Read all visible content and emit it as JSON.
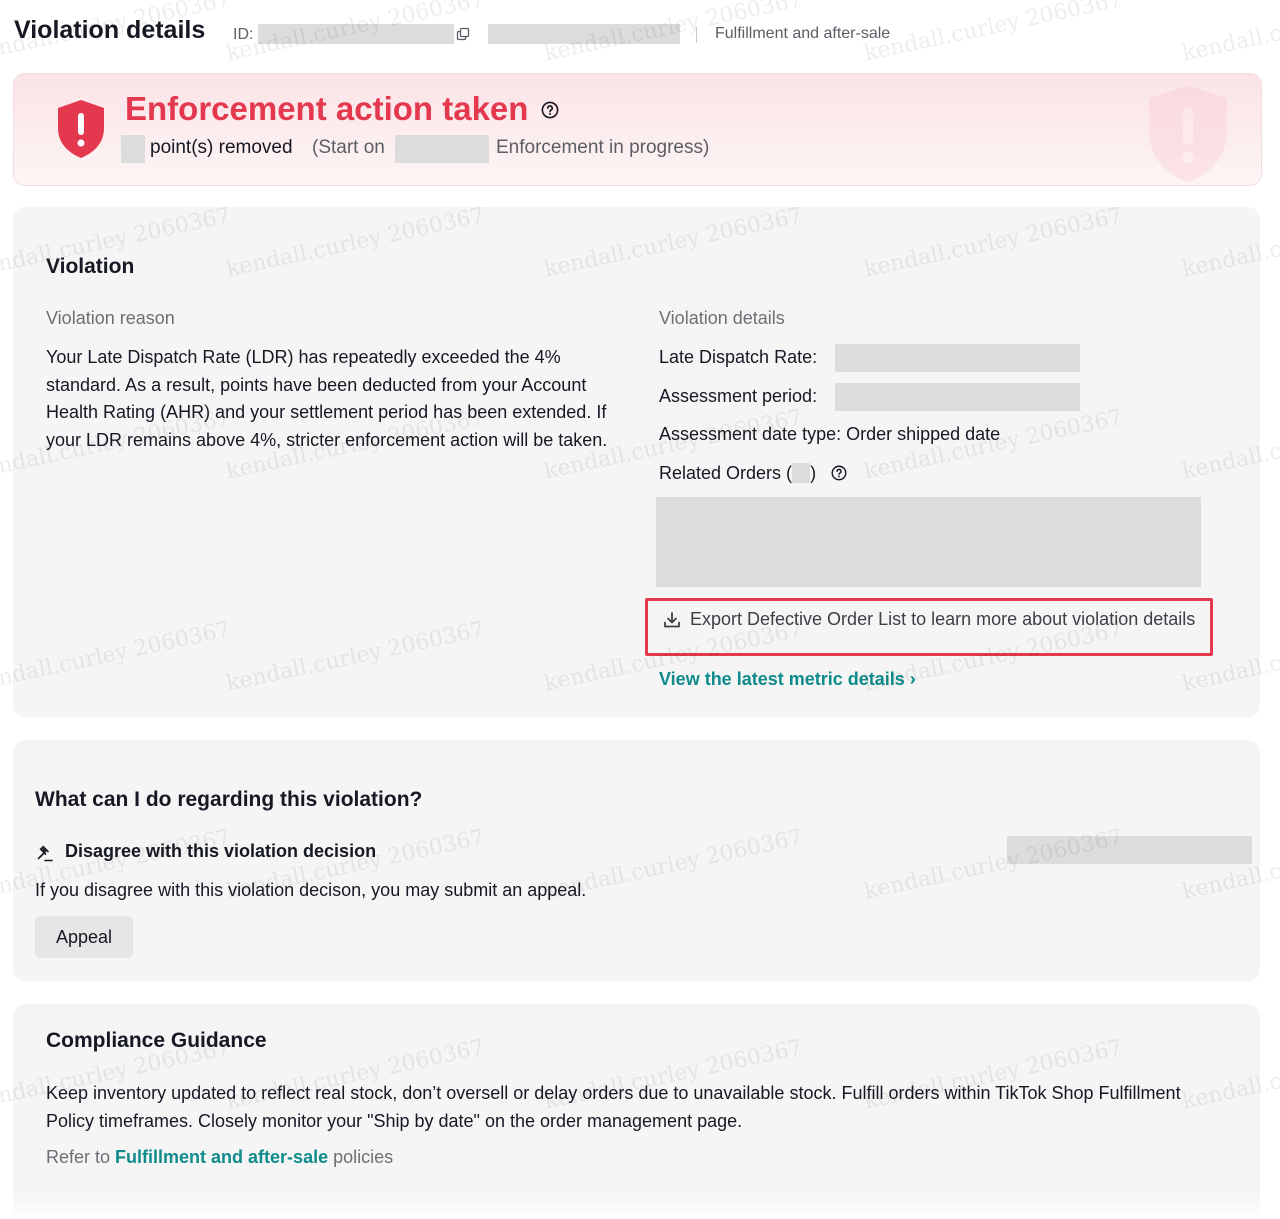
{
  "header": {
    "title": "Violation details",
    "id_label": "ID:",
    "category": "Fulfillment and after-sale"
  },
  "banner": {
    "title": "Enforcement action taken",
    "points_text": "point(s) removed",
    "start_text": "(Start on",
    "progress_text": "Enforcement in progress)"
  },
  "violation": {
    "title": "Violation",
    "reason_label": "Violation reason",
    "reason_text": "Your Late Dispatch Rate (LDR) has repeatedly exceeded the 4% standard. As a result, points have been deducted from your Account Health Rating (AHR) and your settlement period has been extended. If your LDR remains above 4%, stricter enforcement action will be taken.",
    "details_label": "Violation details",
    "late_dispatch_label": "Late Dispatch Rate:",
    "assessment_period_label": "Assessment period:",
    "assessment_date_type": "Assessment date type: Order shipped date",
    "related_orders_label": "Related Orders (",
    "related_orders_close": ")",
    "export_link": "Export Defective Order List to learn more about violation details",
    "metric_link": "View the latest metric details ›"
  },
  "what_to_do": {
    "title": "What can I do regarding this violation?",
    "disagree_title": "Disagree with this violation decision",
    "disagree_text": "If you disagree with this violation decison, you may submit an appeal.",
    "appeal_button": "Appeal"
  },
  "compliance": {
    "title": "Compliance Guidance",
    "text": "Keep inventory updated to reflect real stock, don’t oversell or delay orders due to unavailable stock. Fulfill orders within TikTok Shop Fulfillment Policy timeframes. Closely monitor your \"Ship by date\" on the order management page.",
    "refer_prefix": "Refer to",
    "refer_link": "Fulfillment and after-sale",
    "refer_suffix": "policies"
  },
  "watermark": "kendall.curley 2060367",
  "colors": {
    "alert_red": "#e4384f",
    "link_teal": "#108b8b",
    "section_bg": "#f5f5f5",
    "redaction_gray": "#dcdcdc"
  },
  "icons": [
    "copy-icon",
    "shield-alert-icon",
    "help-icon",
    "download-icon",
    "gavel-icon",
    "chevron-right-icon"
  ]
}
